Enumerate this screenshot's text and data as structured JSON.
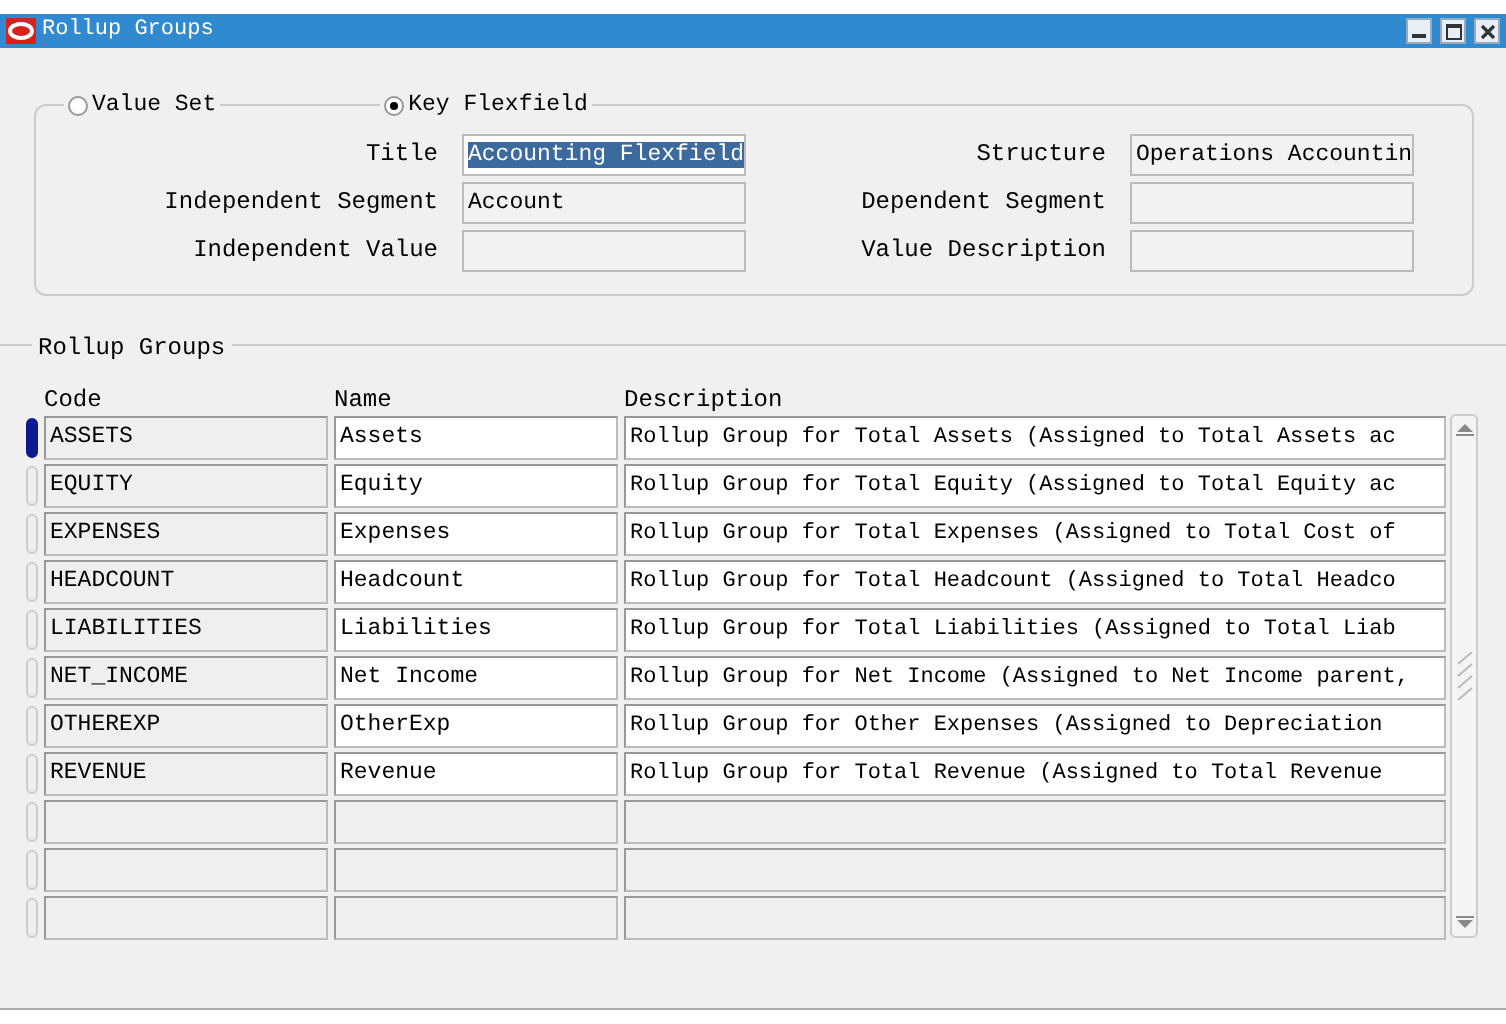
{
  "window": {
    "title": "Rollup Groups"
  },
  "mode_options": [
    {
      "label": "Value Set",
      "selected": false
    },
    {
      "label": "Key Flexfield",
      "selected": true
    }
  ],
  "fields_left": [
    {
      "label": "Title",
      "value": "Accounting Flexfield",
      "highlighted": true
    },
    {
      "label": "Independent Segment",
      "value": "Account",
      "highlighted": false
    },
    {
      "label": "Independent Value",
      "highlighted": false
    }
  ],
  "fields_right": [
    {
      "label": "Structure",
      "value": "Operations Accountin"
    },
    {
      "label": "Dependent Segment"
    },
    {
      "label": "Value Description"
    }
  ],
  "rollup_groups": {
    "title": "Rollup Groups",
    "columns": [
      "Code",
      "Name",
      "Description"
    ],
    "rows": [
      {
        "code": "ASSETS",
        "name": "Assets",
        "description": "Rollup Group for Total Assets (Assigned to Total Assets ac",
        "selected": true
      },
      {
        "code": "EQUITY",
        "name": "Equity",
        "description": "Rollup Group for Total Equity (Assigned to Total Equity ac",
        "selected": false
      },
      {
        "code": "EXPENSES",
        "name": "Expenses",
        "description": "Rollup Group for Total Expenses (Assigned to Total Cost of",
        "selected": false
      },
      {
        "code": "HEADCOUNT",
        "name": "Headcount",
        "description": "Rollup Group for Total Headcount (Assigned to Total Headco",
        "selected": false
      },
      {
        "code": "LIABILITIES",
        "name": "Liabilities",
        "description": "Rollup Group for Total Liabilities (Assigned to Total Liab",
        "selected": false
      },
      {
        "code": "NET_INCOME",
        "name": "Net Income",
        "description": "Rollup Group for Net Income (Assigned to Net Income parent,",
        "selected": false
      },
      {
        "code": "OTHEREXP",
        "name": "OtherExp",
        "description": "Rollup Group for Other Expenses (Assigned to Depreciation",
        "selected": false
      },
      {
        "code": "REVENUE",
        "name": "Revenue",
        "description": "Rollup Group for Total Revenue (Assigned to Total Revenue",
        "selected": false
      }
    ]
  }
}
